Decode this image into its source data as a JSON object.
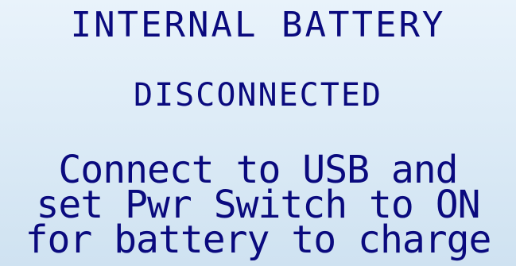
{
  "screen": {
    "title": "INTERNAL BATTERY",
    "status": "DISCONNECTED",
    "message_lines": [
      "Connect to USB and",
      "set Pwr Switch to ON",
      "for battery to charge"
    ]
  },
  "colors": {
    "text": "#0a0a7e",
    "background_top": "#e9f3fb",
    "background_bottom": "#cfe2f1"
  }
}
